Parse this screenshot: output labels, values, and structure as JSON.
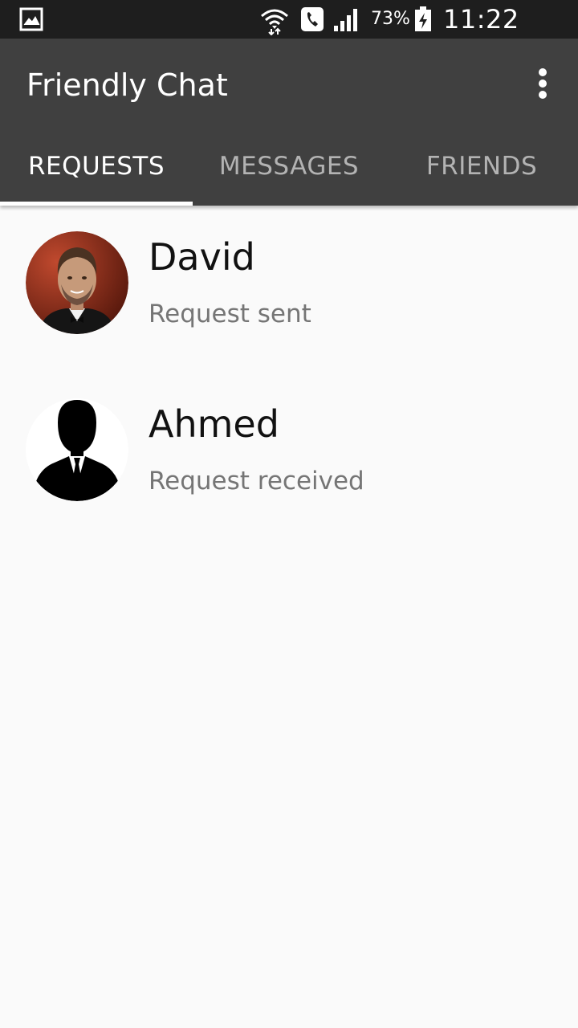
{
  "status_bar": {
    "battery_percent": "73%",
    "time": "11:22 p.m.",
    "icons": [
      "gallery-icon",
      "wifi-icon",
      "call-icon",
      "signal-icon",
      "battery-charging-icon"
    ]
  },
  "app_bar": {
    "title": "Friendly Chat",
    "overflow_icon": "more-vert-icon"
  },
  "tabs": [
    {
      "label": "REQUESTS",
      "active": true
    },
    {
      "label": "MESSAGES",
      "active": false
    },
    {
      "label": "FRIENDS",
      "active": false
    }
  ],
  "requests": [
    {
      "name": "David",
      "status": "Request sent",
      "avatar": "photo"
    },
    {
      "name": "Ahmed",
      "status": "Request received",
      "avatar": "silhouette"
    }
  ],
  "colors": {
    "status_bar": "#1e1e1e",
    "app_bar": "#404040",
    "background": "#fafafa",
    "tab_active": "#ffffff",
    "tab_inactive": "#b3b3b3",
    "secondary_text": "#757575"
  }
}
